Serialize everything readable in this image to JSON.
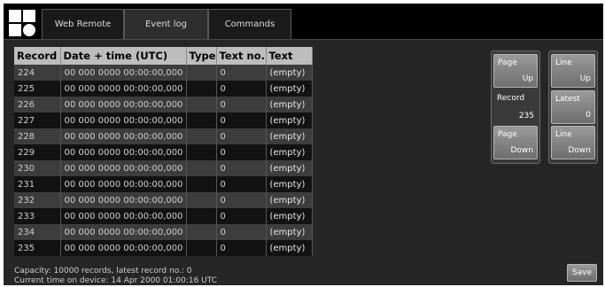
{
  "nav": {
    "tabs": [
      {
        "label": "Web Remote"
      },
      {
        "label": "Event log",
        "active": true
      },
      {
        "label": "Commands"
      }
    ]
  },
  "table": {
    "columns": [
      "Record",
      "Date + time (UTC)",
      "Type",
      "Text no.",
      "Text"
    ],
    "rows": [
      [
        "224",
        "00 000 0000 00:00:00,000",
        "",
        "0",
        "(empty)"
      ],
      [
        "225",
        "00 000 0000 00:00:00,000",
        "",
        "0",
        "(empty)"
      ],
      [
        "226",
        "00 000 0000 00:00:00,000",
        "",
        "0",
        "(empty)"
      ],
      [
        "227",
        "00 000 0000 00:00:00,000",
        "",
        "0",
        "(empty)"
      ],
      [
        "228",
        "00 000 0000 00:00:00,000",
        "",
        "0",
        "(empty)"
      ],
      [
        "229",
        "00 000 0000 00:00:00,000",
        "",
        "0",
        "(empty)"
      ],
      [
        "230",
        "00 000 0000 00:00:00,000",
        "",
        "0",
        "(empty)"
      ],
      [
        "231",
        "00 000 0000 00:00:00,000",
        "",
        "0",
        "(empty)"
      ],
      [
        "232",
        "00 000 0000 00:00:00,000",
        "",
        "0",
        "(empty)"
      ],
      [
        "233",
        "00 000 0000 00:00:00,000",
        "",
        "0",
        "(empty)"
      ],
      [
        "234",
        "00 000 0000 00:00:00,000",
        "",
        "0",
        "(empty)"
      ],
      [
        "235",
        "00 000 0000 00:00:00,000",
        "",
        "0",
        "(empty)"
      ]
    ]
  },
  "info": {
    "capacity": "Capacity: 10000 records, latest record no.: 0",
    "current_time": "Current time on device: 14 Apr 2000 01:00:16 UTC"
  },
  "page_panel": {
    "page_up": {
      "line1": "Page",
      "line2": "Up"
    },
    "record": {
      "line1": "Record",
      "line2": "235"
    },
    "page_down": {
      "line1": "Page",
      "line2": "Down"
    }
  },
  "line_panel": {
    "line_up": {
      "line1": "Line",
      "line2": "Up"
    },
    "latest": {
      "line1": "Latest",
      "line2": "0"
    },
    "line_down": {
      "line1": "Line",
      "line2": "Down"
    }
  },
  "save_label": "Save",
  "colors": {
    "background": "#262626",
    "header_bg": "#bdbdbd",
    "row_light": "#3d3d3d",
    "row_dark": "#121212",
    "button_top": "#9a9a9a",
    "button_bottom": "#6e6e6e"
  },
  "icons": {
    "logo": "four-square-logo-icon"
  }
}
